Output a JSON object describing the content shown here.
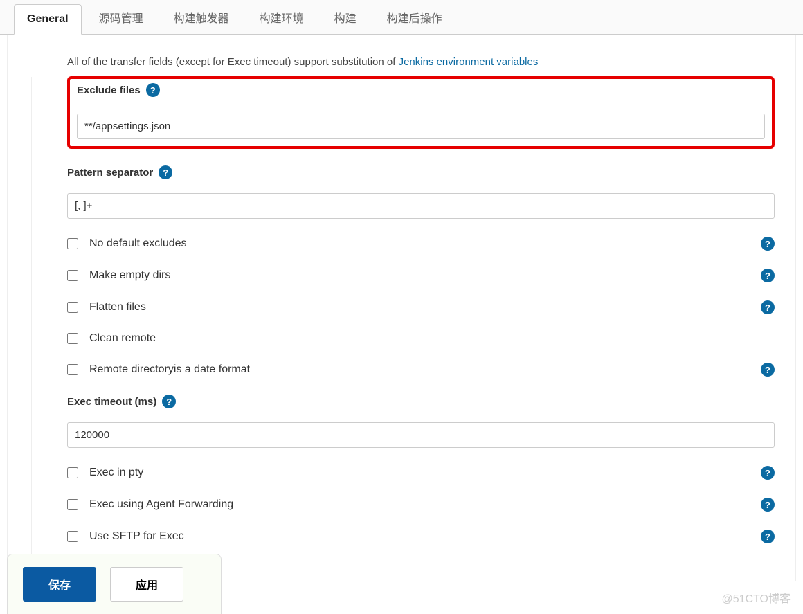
{
  "tabs": {
    "items": [
      {
        "label": "General",
        "active": true
      },
      {
        "label": "源码管理"
      },
      {
        "label": "构建触发器"
      },
      {
        "label": "构建环境"
      },
      {
        "label": "构建"
      },
      {
        "label": "构建后操作"
      }
    ]
  },
  "info_text_prefix": "All of the transfer fields (except for Exec timeout) support substitution of ",
  "info_link_text": "Jenkins environment variables",
  "fields": {
    "exclude_files": {
      "label": "Exclude files",
      "value": "**/appsettings.json"
    },
    "pattern_separator": {
      "label": "Pattern separator",
      "value": "[, ]+"
    },
    "exec_timeout": {
      "label": "Exec timeout (ms)",
      "value": "120000"
    }
  },
  "checkboxes": {
    "no_default_excludes": {
      "label": "No default excludes",
      "help": true
    },
    "make_empty_dirs": {
      "label": "Make empty dirs",
      "help": true
    },
    "flatten_files": {
      "label": "Flatten files",
      "help": true
    },
    "clean_remote": {
      "label": "Clean remote",
      "help": false
    },
    "remote_dir_date": {
      "label": "Remote directoryis a date format",
      "help": true
    },
    "exec_in_pty": {
      "label": "Exec in pty",
      "help": true
    },
    "exec_agent_fwd": {
      "label": "Exec using Agent Forwarding",
      "help": true
    },
    "use_sftp": {
      "label": "Use SFTP for Exec",
      "help": true
    }
  },
  "buttons": {
    "save": "保存",
    "apply": "应用"
  },
  "watermark": "@51CTO博客"
}
